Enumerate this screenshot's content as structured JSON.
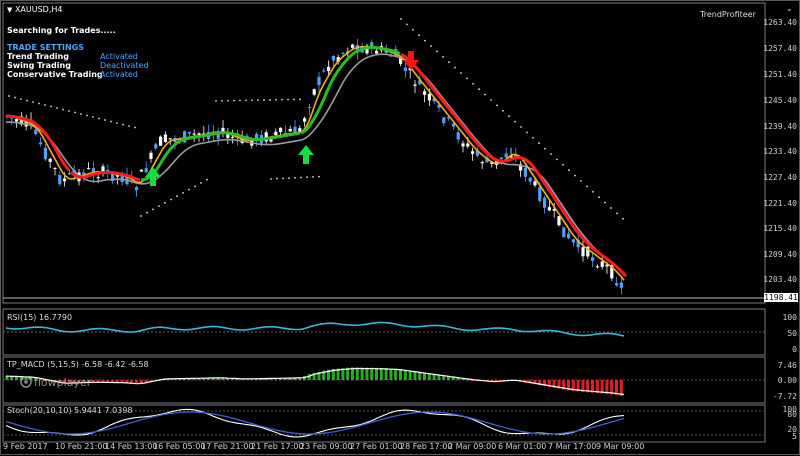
{
  "chart": {
    "symbol_label": "XAUUSD,H4",
    "indicator_name": "TrendProfiteer",
    "status_text": "Searching for Trades.....",
    "settings_title": "TRADE SETTINGS",
    "settings": [
      {
        "label": "Trend Trading",
        "value": "Activated"
      },
      {
        "label": "Swing Trading",
        "value": "Deactivated"
      },
      {
        "label": "Conservative Trading",
        "value": "Activated"
      }
    ],
    "current_price": "1198.41",
    "price_axis": [
      "1263.40",
      "1257.40",
      "1251.40",
      "1245.40",
      "1239.40",
      "1233.40",
      "1227.40",
      "1221.40",
      "1215.40",
      "1209.40",
      "1203.40"
    ],
    "time_axis": [
      "9 Feb 2017",
      "10 Feb 21:00",
      "14 Feb 13:00",
      "16 Feb 05:00",
      "17 Feb 21:00",
      "21 Feb 17:00",
      "23 Feb 09:00",
      "27 Feb 01:00",
      "28 Feb 17:00",
      "2 Mar 09:00",
      "6 Mar 01:00",
      "7 Mar 17:00",
      "9 Mar 09:00"
    ],
    "colors": {
      "bull": "#ffffff",
      "bear": "#4ea3ff",
      "ma_fast": "#f0b020",
      "ma_trend_up": "#22c020",
      "ma_trend_down": "#ff1a1a",
      "ma_slow": "#9a9aa0",
      "rsi": "#38b8e0",
      "macd_up": "#20b020",
      "macd_down": "#e02020"
    }
  },
  "rsi": {
    "label": "RSI(15) 16.7790",
    "axis": [
      "100",
      "50",
      "0"
    ]
  },
  "macd": {
    "label": "TP_MACD (5,15,5) -6.58 -6.42 -6.58",
    "axis": [
      "7.46",
      "0.00",
      "-7.72"
    ],
    "watermark": "flowplayer"
  },
  "stoch": {
    "label": "Stoch(20,10,10) 5.9441 7.0398",
    "axis": [
      "100",
      "80",
      "20",
      "5"
    ]
  }
}
